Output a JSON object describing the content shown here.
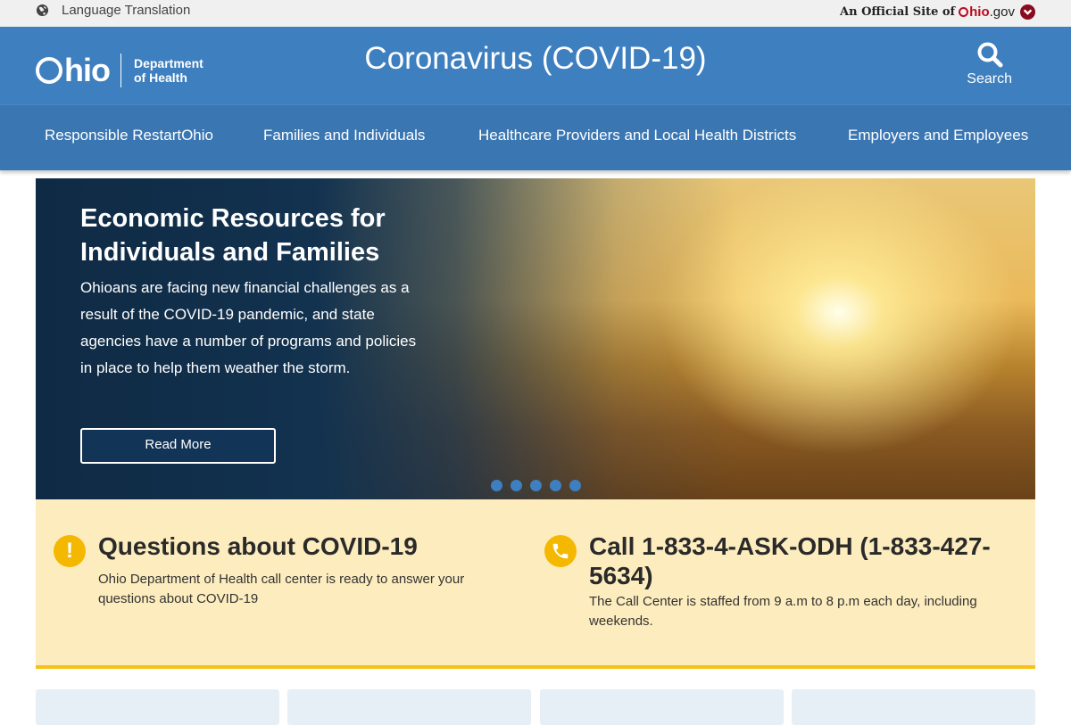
{
  "utility_bar": {
    "language_label": "Language Translation",
    "official_prefix": "An Official Site of",
    "ohio_gov": {
      "o": "O",
      "hio": "hio",
      "tld": ".gov"
    }
  },
  "header": {
    "logo": {
      "ohio": "hio",
      "dept_line1": "Department",
      "dept_line2": "of Health"
    },
    "title": "Coronavirus (COVID-19)",
    "search_label": "Search"
  },
  "nav": {
    "items": [
      {
        "label": "Responsible RestartOhio"
      },
      {
        "label": "Families and Individuals"
      },
      {
        "label": "Healthcare Providers and Local Health Districts"
      },
      {
        "label": "Employers and Employees"
      }
    ]
  },
  "hero": {
    "title": "Economic Resources for Individuals and Families",
    "text": "Ohioans are facing new financial challenges as a result of the COVID-19 pandemic, and state agencies have a number of programs and policies in place to help them weather the storm.",
    "button_label": "Read More",
    "slide_count": 5
  },
  "info": {
    "questions": {
      "icon": "exclamation-icon",
      "icon_glyph": "!",
      "title": "Questions about COVID-19",
      "text": "Ohio Department of Health call center is ready to answer your questions about COVID-19"
    },
    "call": {
      "icon": "phone-icon",
      "title": "Call 1-833-4-ASK-ODH (1-833-427-5634)",
      "text": "The Call Center is staffed from 9 a.m to 8 p.m each day, including weekends."
    }
  },
  "colors": {
    "header_blue": "#3e7fbf",
    "nav_blue": "#3a76b2",
    "accent_yellow": "#f5c215",
    "info_bg": "#fdedbe",
    "ohio_red": "#bb0a21"
  }
}
